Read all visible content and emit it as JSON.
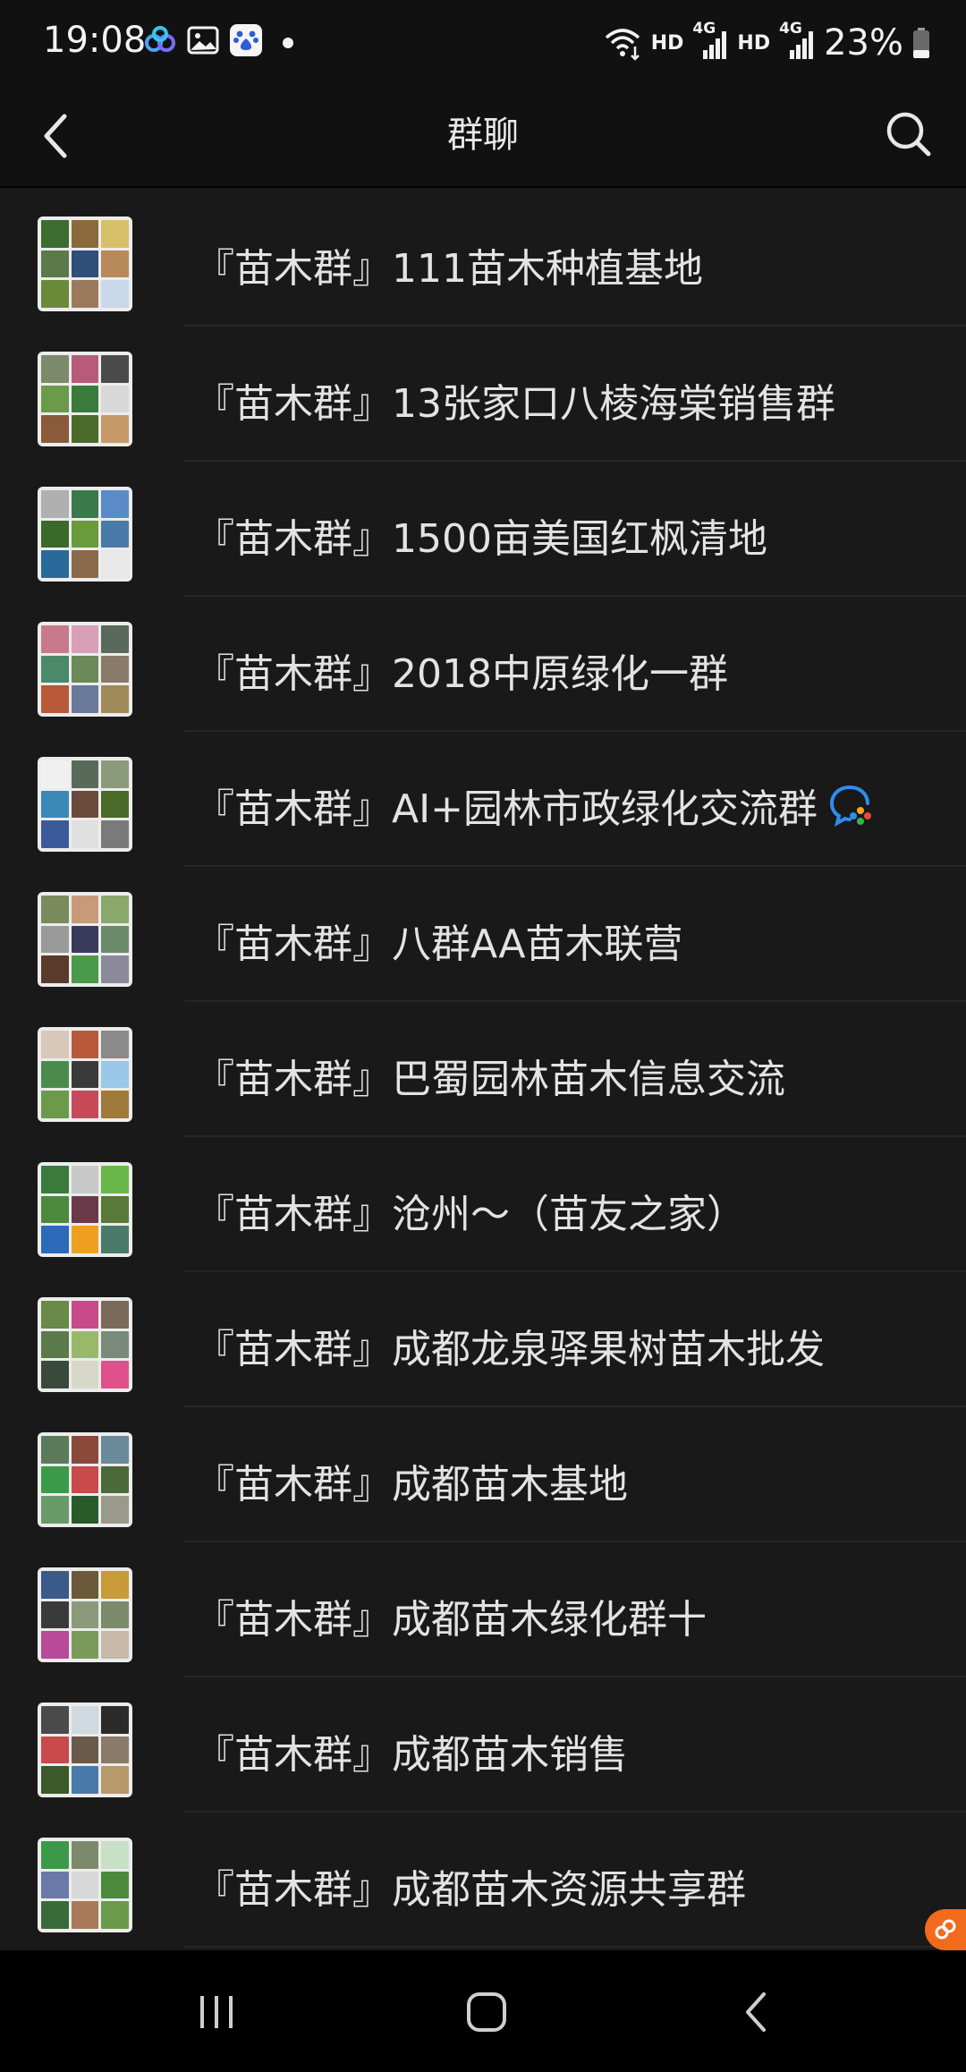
{
  "status_bar": {
    "time": "19:08",
    "network_labels": [
      "HD",
      "HD"
    ],
    "signal_labels": [
      "4G",
      "4G"
    ],
    "battery": "23%",
    "icons": [
      "baidu-netdisk-icon",
      "gallery-icon",
      "baidu-icon",
      "wifi-icon",
      "signal-icon",
      "battery-icon"
    ]
  },
  "header": {
    "title": "群聊",
    "back_icon": "chevron-left-icon",
    "search_icon": "search-icon"
  },
  "groups": [
    {
      "name": "『苗木群』111苗木种植基地"
    },
    {
      "name": "『苗木群』13张家口八棱海棠销售群"
    },
    {
      "name": "『苗木群』1500亩美国红枫清地"
    },
    {
      "name": "『苗木群』2018中原绿化一群"
    },
    {
      "name": "『苗木群』AI+园林市政绿化交流群",
      "badge_icon": "enterprise-wechat-icon"
    },
    {
      "name": "『苗木群』八群AA苗木联营"
    },
    {
      "name": "『苗木群』巴蜀园林苗木信息交流"
    },
    {
      "name": "『苗木群』沧州～（苗友之家）"
    },
    {
      "name": "『苗木群』成都龙泉驿果树苗木批发"
    },
    {
      "name": "『苗木群』成都苗木基地"
    },
    {
      "name": "『苗木群』成都苗木绿化群十"
    },
    {
      "name": "『苗木群』成都苗木销售"
    },
    {
      "name": "『苗木群』成都苗木资源共享群"
    }
  ],
  "colors": {
    "background": "#191919",
    "bar": "#111111",
    "text": "#e3e3e3",
    "accent_orange": "#f26b1d"
  },
  "nav": {
    "icons": [
      "recent-apps-icon",
      "home-icon",
      "back-icon"
    ]
  }
}
